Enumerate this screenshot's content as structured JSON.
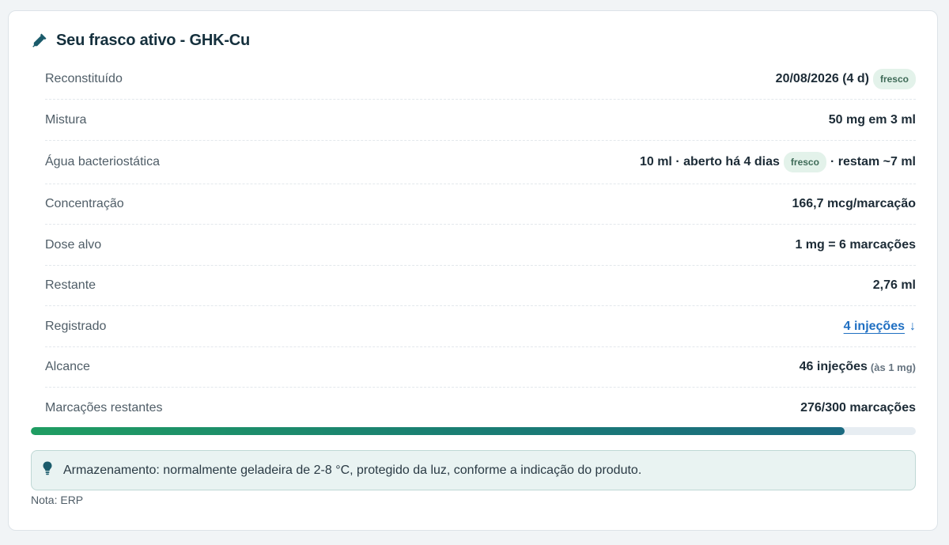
{
  "card": {
    "title": "Seu frasco ativo - GHK-Cu",
    "icon": "pipette-icon",
    "accent": "#1b5b6b"
  },
  "rows": [
    {
      "label": "Reconstituído",
      "value": "20/08/2026 (4 d)",
      "badge": "fresco"
    },
    {
      "label": "Mistura",
      "value": "50 mg em 3 ml"
    },
    {
      "label": "Água bacteriostática",
      "value_pre": "10 ml · aberto há 4 dias",
      "badge": "fresco",
      "value_post": "· restam ~7 ml"
    },
    {
      "label": "Concentração",
      "value": "166,7 mcg/marcação"
    },
    {
      "label": "Dose alvo",
      "value": "1 mg = 6 marcações"
    },
    {
      "label": "Restante",
      "value": "2,76 ml"
    },
    {
      "label": "Registrado",
      "link": "4 injeções",
      "link_icon": "arrow-down-icon",
      "link_glyph": "↓"
    },
    {
      "label": "Alcance",
      "value": "46 injeções",
      "note": "(às 1 mg)"
    },
    {
      "label": "Marcações restantes",
      "value": "276/300 marcações"
    }
  ],
  "progress": {
    "current": 276,
    "total": 300,
    "colors": [
      "#1f9d62",
      "#1b6a80"
    ]
  },
  "storage": {
    "icon": "lightbulb-icon",
    "text": "Armazenamento: normalmente geladeira de 2-8 °C, protegido da luz, conforme a indicação do produto."
  },
  "footnote": "Nota: ERP"
}
